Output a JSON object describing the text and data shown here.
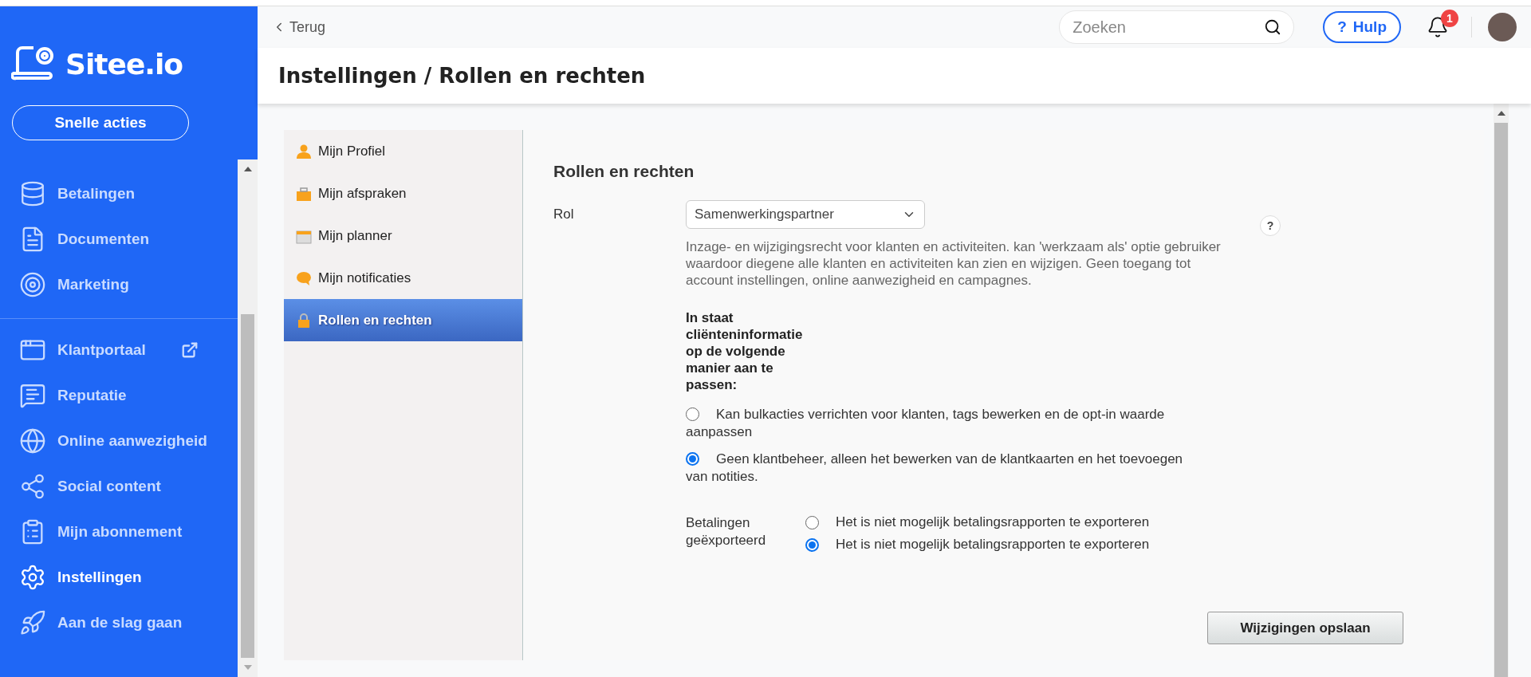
{
  "sidebar": {
    "logo": "Sitee.io",
    "quick_action": "Snelle acties",
    "groups": [
      [
        {
          "label": "Betalingen",
          "selected": false,
          "external": false
        },
        {
          "label": "Documenten",
          "selected": false,
          "external": false
        },
        {
          "label": "Marketing",
          "selected": false,
          "external": false
        }
      ],
      [
        {
          "label": "Klantportaal",
          "selected": false,
          "external": true
        },
        {
          "label": "Reputatie",
          "selected": false,
          "external": false
        },
        {
          "label": "Online aanwezigheid",
          "selected": false,
          "external": false
        },
        {
          "label": "Social content",
          "selected": false,
          "external": false
        },
        {
          "label": "Mijn abonnement",
          "selected": false,
          "external": false
        },
        {
          "label": "Instellingen",
          "selected": true,
          "external": false
        },
        {
          "label": "Aan de slag gaan",
          "selected": false,
          "external": false
        }
      ]
    ]
  },
  "topbar": {
    "back": "Terug",
    "search": {
      "placeholder": "Zoeken"
    },
    "help": {
      "mark": "?",
      "label": "Hulp"
    },
    "notifications": "1"
  },
  "page_title": "Instellingen / Rollen en rechten",
  "settings_menu": [
    {
      "label": "Mijn Profiel",
      "selected": false
    },
    {
      "label": "Mijn afspraken",
      "selected": false
    },
    {
      "label": "Mijn planner",
      "selected": false
    },
    {
      "label": "Mijn notificaties",
      "selected": false
    },
    {
      "label": "Rollen en rechten",
      "selected": true
    }
  ],
  "form": {
    "title": "Rollen en rechten",
    "role_label": "Rol",
    "role_value": "Samenwerkingspartner",
    "help_mark": "?",
    "description": "Inzage- en wijzigingsrecht voor klanten en activiteiten. kan 'werkzaam als' optie gebruiker waardoor diegene alle klanten en activiteiten kan zien en wijzigen. Geen toegang tot account instellingen, online aanwezigheid en campagnes.",
    "client_heading": "In staat cliënteninformatie op de volgende manier aan te passen:",
    "client_options": [
      {
        "label": "Kan bulkacties verrichten voor klanten, tags bewerken en de opt-in waarde aanpassen",
        "selected": false
      },
      {
        "label": "Geen klantbeheer, alleen het bewerken van de klantkaarten en het toevoegen van notities.",
        "selected": true
      }
    ],
    "payments_label": "Betalingen geëxporteerd",
    "payment_options": [
      {
        "label": "Het is niet mogelijk betalingsrapporten te exporteren",
        "selected": false
      },
      {
        "label": "Het is niet mogelijk betalingsrapporten te exporteren",
        "selected": true
      }
    ],
    "save": "Wijzigingen opslaan"
  }
}
